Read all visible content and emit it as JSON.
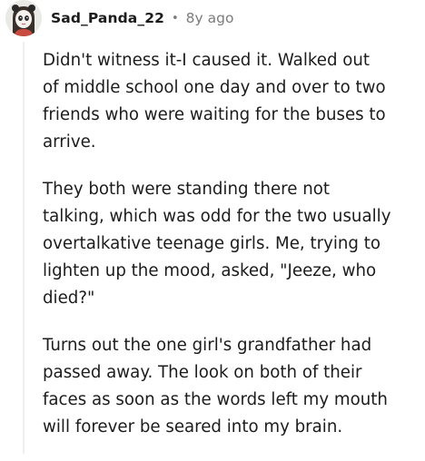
{
  "comment": {
    "username": "Sad_Panda_22",
    "separator": "•",
    "timestamp": "8y ago",
    "avatar_icon": "panda-avatar-icon",
    "paragraphs": [
      "Didn't witness it-I caused it. Walked out\nof middle school one day and over to two\nfriends who were waiting for the buses to\narrive.",
      "They both were standing there not\ntalking, which was odd for the two usually\novertalkative teenage girls. Me, trying to\nlighten up the mood, asked, \"Jeeze, who\ndied?\"",
      "Turns out the one girl's grandfather had\npassed away. The look on both of their\nfaces as soon as the words left my mouth\nwill forever be seared into my brain."
    ]
  },
  "colors": {
    "text": "#1c1c1c",
    "meta": "#7c7c7c",
    "thread_line": "#edeff1",
    "avatar_bg": "#e9e9e6"
  }
}
